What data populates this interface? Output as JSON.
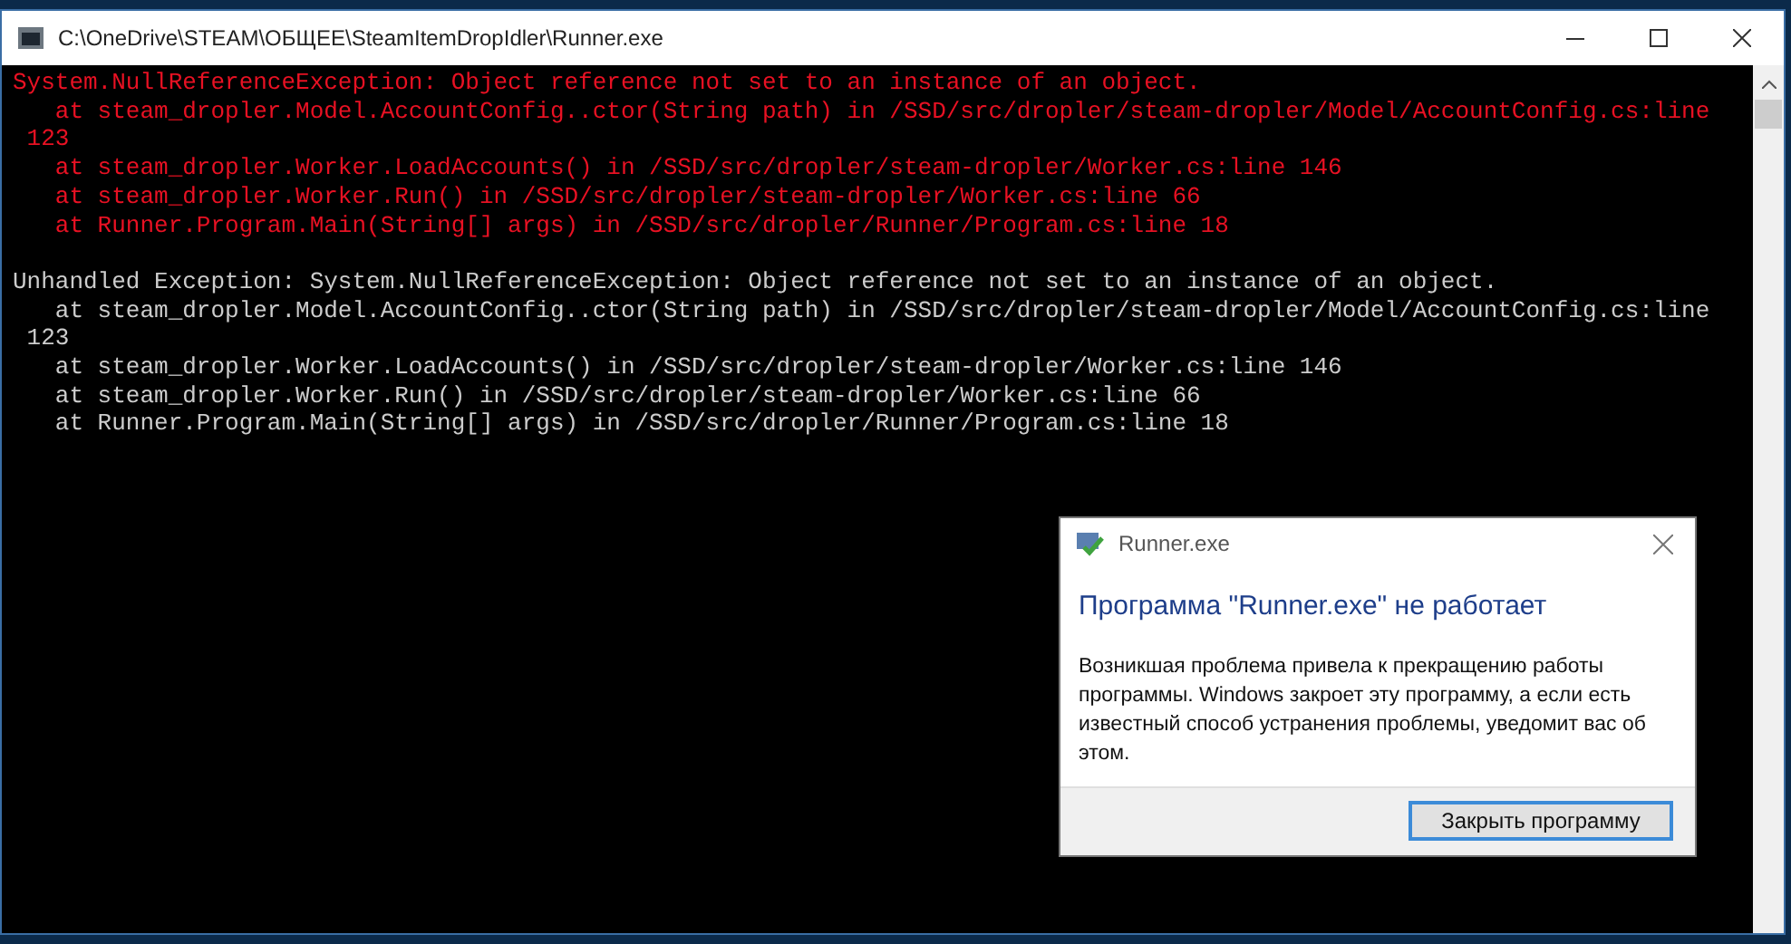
{
  "window": {
    "title": "C:\\OneDrive\\STEAM\\ОБЩЕЕ\\SteamItemDropIdler\\Runner.exe"
  },
  "console": {
    "lines": [
      {
        "kind": "error",
        "text": "System.NullReferenceException: Object reference not set to an instance of an object."
      },
      {
        "kind": "error",
        "text": "   at steam_dropler.Model.AccountConfig..ctor(String path) in /SSD/src/dropler/steam-dropler/Model/AccountConfig.cs:line"
      },
      {
        "kind": "error",
        "text": " 123"
      },
      {
        "kind": "error",
        "text": "   at steam_dropler.Worker.LoadAccounts() in /SSD/src/dropler/steam-dropler/Worker.cs:line 146"
      },
      {
        "kind": "error",
        "text": "   at steam_dropler.Worker.Run() in /SSD/src/dropler/steam-dropler/Worker.cs:line 66"
      },
      {
        "kind": "error",
        "text": "   at Runner.Program.Main(String[] args) in /SSD/src/dropler/Runner/Program.cs:line 18"
      },
      {
        "kind": "blank"
      },
      {
        "kind": "normal",
        "text": "Unhandled Exception: System.NullReferenceException: Object reference not set to an instance of an object."
      },
      {
        "kind": "normal",
        "text": "   at steam_dropler.Model.AccountConfig..ctor(String path) in /SSD/src/dropler/steam-dropler/Model/AccountConfig.cs:line"
      },
      {
        "kind": "normal",
        "text": " 123"
      },
      {
        "kind": "normal",
        "text": "   at steam_dropler.Worker.LoadAccounts() in /SSD/src/dropler/steam-dropler/Worker.cs:line 146"
      },
      {
        "kind": "normal",
        "text": "   at steam_dropler.Worker.Run() in /SSD/src/dropler/steam-dropler/Worker.cs:line 66"
      },
      {
        "kind": "normal",
        "text": "   at Runner.Program.Main(String[] args) in /SSD/src/dropler/Runner/Program.cs:line 18"
      }
    ]
  },
  "dialog": {
    "title": "Runner.exe",
    "heading": "Программа \"Runner.exe\" не работает",
    "message": "Возникшая проблема привела к прекращению работы программы. Windows закроет эту программу, а если есть известный способ устранения проблемы, уведомит вас об этом.",
    "button": "Закрыть программу"
  }
}
